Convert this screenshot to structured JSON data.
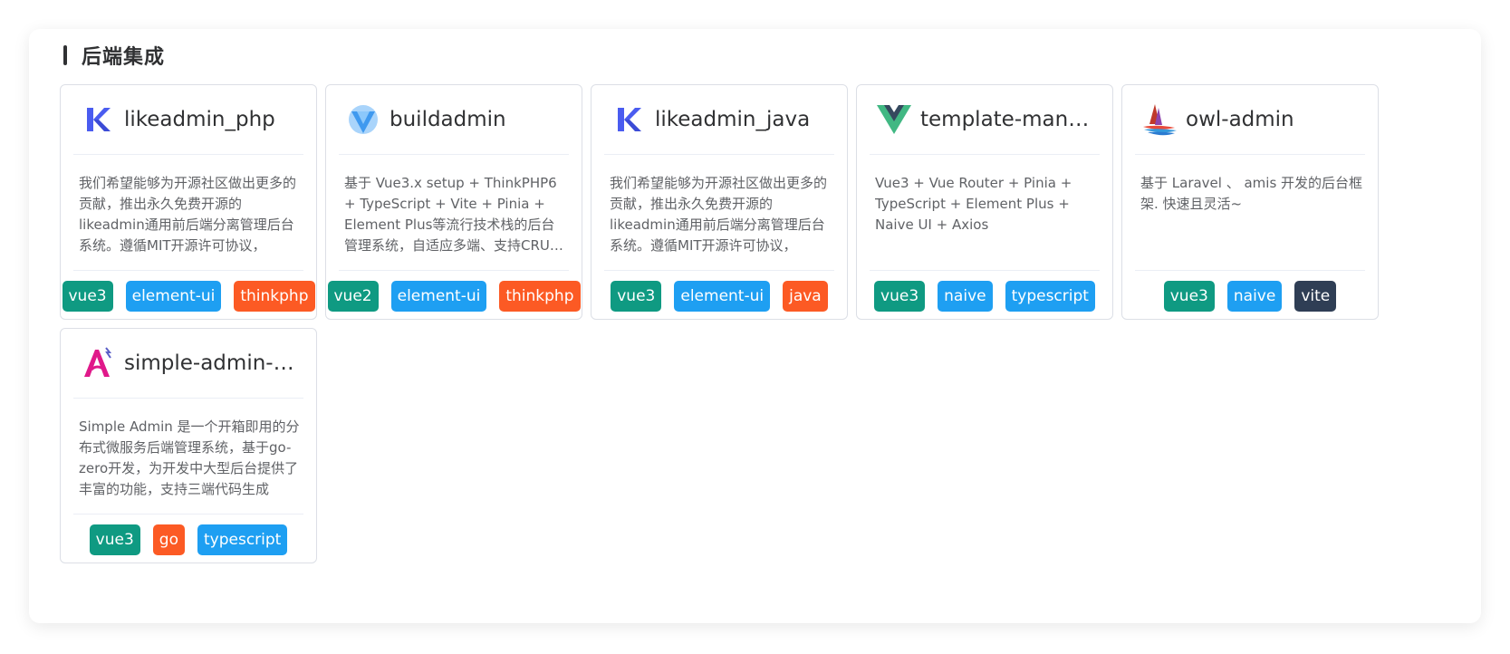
{
  "section": {
    "title": "后端集成"
  },
  "cards": [
    {
      "title": "likeadmin_php",
      "logo": "likeadmin-logo",
      "desc": "我们希望能够为开源社区做出更多的贡献，推出永久免费开源的likeadmin通用前后端分离管理后台系统。遵循MIT开源许可协议，",
      "tags": [
        "vue3",
        "element-ui",
        "thinkphp"
      ]
    },
    {
      "title": "buildadmin",
      "logo": "buildadmin-logo",
      "desc": "基于 Vue3.x setup + ThinkPHP6 + TypeScript + Vite + Pinia + Element Plus等流行技术栈的后台管理系统，自适应多端、支持CRUD代码生成",
      "tags": [
        "vue2",
        "element-ui",
        "thinkphp"
      ]
    },
    {
      "title": "likeadmin_java",
      "logo": "likeadmin-logo",
      "desc": "我们希望能够为开源社区做出更多的贡献，推出永久免费开源的likeadmin通用前后端分离管理后台系统。遵循MIT开源许可协议，",
      "tags": [
        "vue3",
        "element-ui",
        "java"
      ]
    },
    {
      "title": "template-management-system",
      "logo": "vue-logo",
      "desc": "Vue3 + Vue Router + Pinia + TypeScript + Element Plus + Naive UI + Axios",
      "tags": [
        "vue3",
        "naive",
        "typescript"
      ]
    },
    {
      "title": "owl-admin",
      "logo": "owl-admin-logo",
      "desc": "基于 Laravel 、 amis 开发的后台框架. 快速且灵活~",
      "tags": [
        "vue3",
        "naive",
        "vite"
      ]
    },
    {
      "title": "simple-admin-core",
      "logo": "simple-admin-logo",
      "desc": "Simple Admin 是一个开箱即用的分布式微服务后端管理系统，基于go-zero开发，为开发中大型后台提供了丰富的功能，支持三端代码生成",
      "tags": [
        "vue3",
        "go",
        "typescript"
      ]
    }
  ],
  "colors": {
    "vue": "#0f9a82",
    "blue": "#1e9ff2",
    "orange": "#fc5a24",
    "dark": "#2f3e55"
  }
}
